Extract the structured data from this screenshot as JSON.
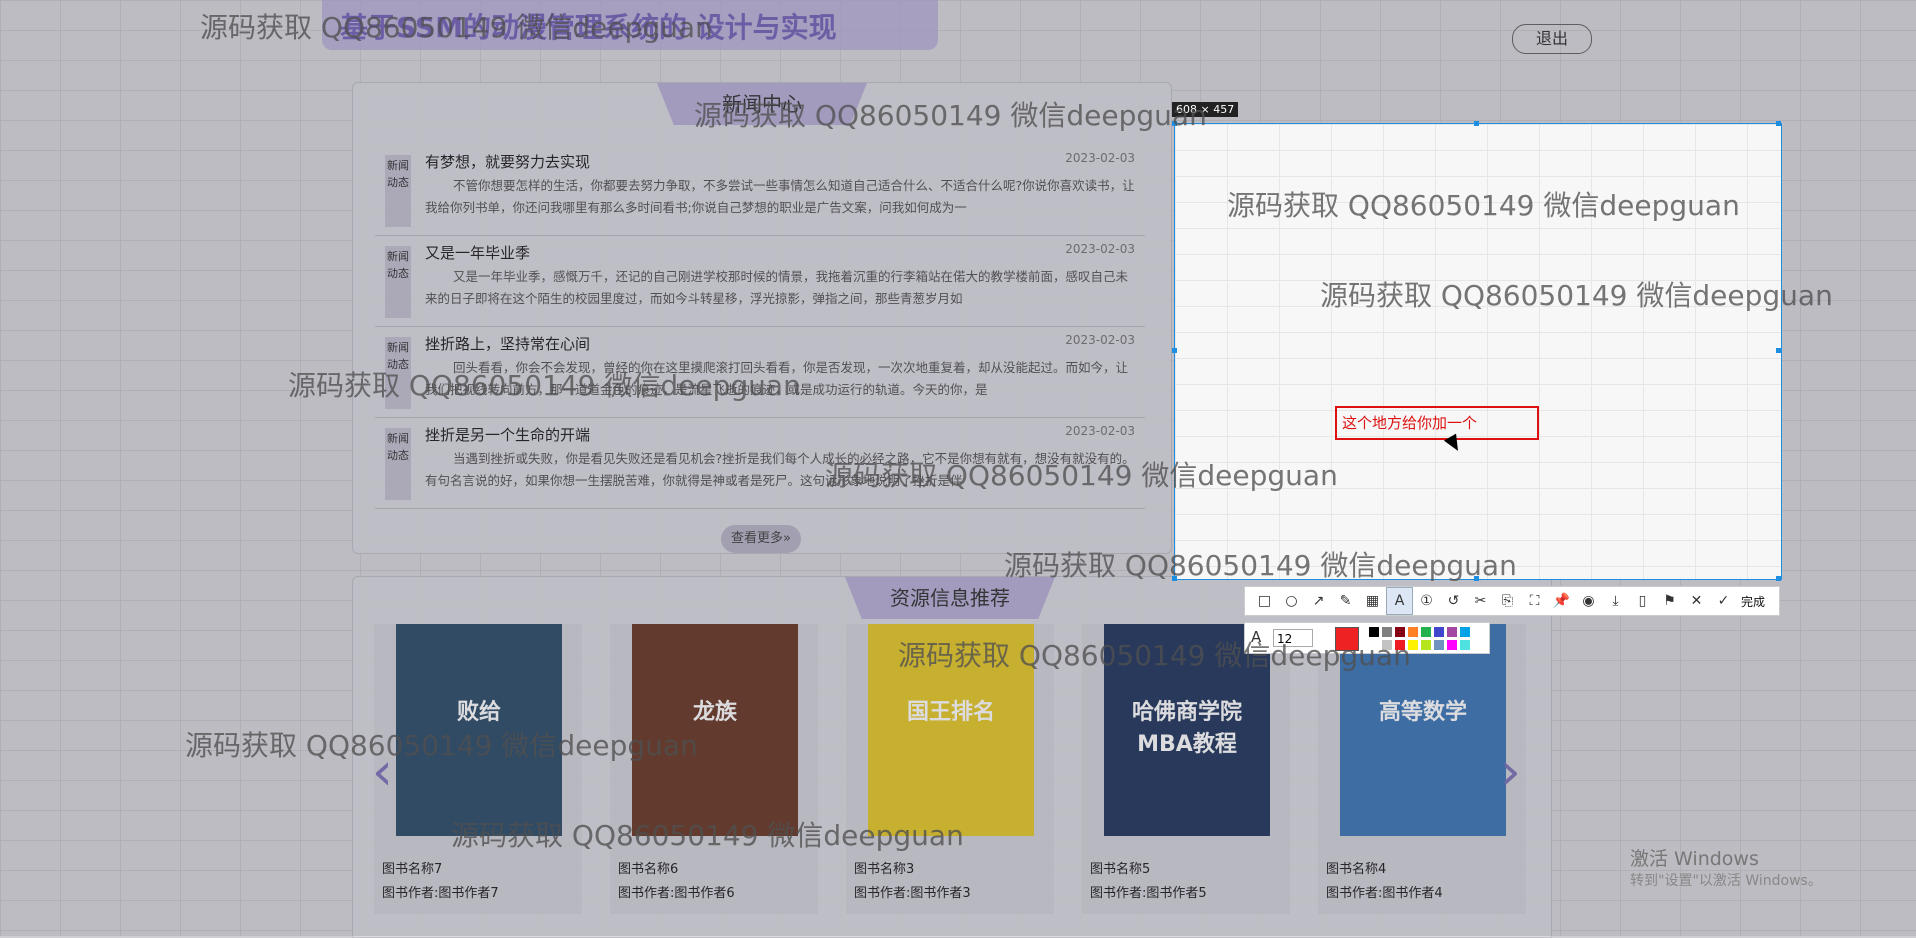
{
  "header": {
    "title": "基于SSM的动漫管理系统的 设计与实现",
    "logout": "退出"
  },
  "news": {
    "heading": "新闻中心",
    "more": "查看更多»",
    "items": [
      {
        "tag": "新闻动态",
        "title": "有梦想，就要努力去实现",
        "date": "2023-02-03",
        "body": "不管你想要怎样的生活，你都要去努力争取，不多尝试一些事情怎么知道自己适合什么、不适合什么呢?你说你喜欢读书，让我给你列书单，你还问我哪里有那么多时间看书;你说自己梦想的职业是广告文案，问我如何成为一"
      },
      {
        "tag": "新闻动态",
        "title": "又是一年毕业季",
        "date": "2023-02-03",
        "body": "又是一年毕业季，感慨万千，还记的自己刚进学校那时候的情景，我拖着沉重的行李箱站在偌大的教学楼前面，感叹自己未来的日子即将在这个陌生的校园里度过，而如今斗转星移，浮光掠影，弹指之间，那些青葱岁月如"
      },
      {
        "tag": "新闻动态",
        "title": "挫折路上，坚持常在心间",
        "date": "2023-02-03",
        "body": "回头看看，你会不会发现，曾经的你在这里摸爬滚打回头看看，你是否发现，一次次地重复着，却从没能起过。而如今，让我们把视线转向前方，那一道道金色的痕迹，是流星飞逝的痕迹，或是成功运行的轨道。今天的你，是"
      },
      {
        "tag": "新闻动态",
        "title": "挫折是另一个生命的开端",
        "date": "2023-02-03",
        "body": "当遇到挫折或失败，你是看见失败还是看见机会?挫折是我们每个人成长的必经之路，它不是你想有就有，想没有就没有的。有句名言说的好，如果你想一生摆脱苦难，你就得是神或者是死尸。这句话形象地说明了挫折是伴"
      }
    ]
  },
  "resources": {
    "heading": "资源信息推荐",
    "books": [
      {
        "name": "图书名称7",
        "author": "图书作者:图书作者7",
        "cover_color": "#2f4f6a",
        "cover_text": "败给"
      },
      {
        "name": "图书名称6",
        "author": "图书作者:图书作者6",
        "cover_color": "#6b3b28",
        "cover_text": "龙族"
      },
      {
        "name": "图书名称3",
        "author": "图书作者:图书作者3",
        "cover_color": "#e6c82a",
        "cover_text": "国王排名"
      },
      {
        "name": "图书名称5",
        "author": "图书作者:图书作者5",
        "cover_color": "#24395e",
        "cover_text": "哈佛商学院MBA教程"
      },
      {
        "name": "图书名称4",
        "author": "图书作者:图书作者4",
        "cover_color": "#3f78b8",
        "cover_text": "高等数学"
      }
    ]
  },
  "watermark": "源码获取 QQ86050149 微信deepguan",
  "capture": {
    "size_label": "608 × 457",
    "text_annotation": "这个地方给你加一个",
    "font_size": "12",
    "done_label": "完成",
    "tools": [
      "rect-tool-icon",
      "ellipse-tool-icon",
      "arrow-tool-icon",
      "pen-tool-icon",
      "mosaic-tool-icon",
      "text-tool-icon",
      "number-tool-icon",
      "undo-icon",
      "ai-icon",
      "translate-icon",
      "ocr-icon",
      "pin-icon",
      "record-icon",
      "download-icon",
      "save-icon",
      "bookmark-icon",
      "close-icon"
    ],
    "colors": [
      "#000000",
      "#7f7f7f",
      "#880015",
      "#ff7f27",
      "#22b14c",
      "#3f48cc",
      "#a349a4",
      "#00a2e8",
      "#ffffff",
      "#c3c3c3",
      "#ed1c24",
      "#fff200",
      "#b5e61d",
      "#7092be",
      "#ff00ff",
      "#4fe0e0"
    ]
  },
  "windows": {
    "line1": "激活 Windows",
    "line2": "转到\"设置\"以激活 Windows。"
  }
}
